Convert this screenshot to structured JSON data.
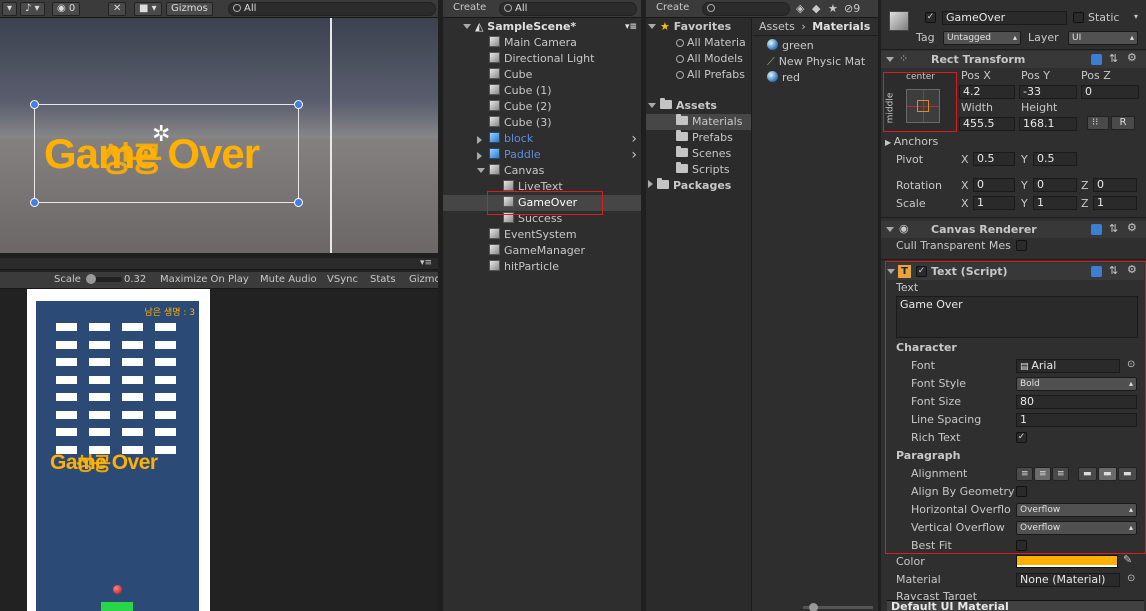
{
  "scene_view": {
    "toolbar": {
      "layers_count": "0",
      "gizmos": "Gizmos",
      "search_placeholder": "All"
    },
    "game_text": "Game Over",
    "overlap_text": "성공"
  },
  "game_view": {
    "toolbar": {
      "scale_label": "Scale",
      "scale_value": "0.32",
      "maximize": "Maximize On Play",
      "mute": "Mute Audio",
      "vsync": "VSync",
      "stats": "Stats",
      "gizmos": "Gizmos"
    },
    "lives_text": "남은 생명 : 3",
    "game_text": "Game Over",
    "overlap_text": "성공"
  },
  "hierarchy": {
    "create": "Create",
    "search_placeholder": "All",
    "scene": "SampleScene*",
    "items": [
      {
        "label": "Main Camera"
      },
      {
        "label": "Directional Light"
      },
      {
        "label": "Cube"
      },
      {
        "label": "Cube (1)"
      },
      {
        "label": "Cube (2)"
      },
      {
        "label": "Cube (3)"
      },
      {
        "label": "block"
      },
      {
        "label": "Paddle"
      },
      {
        "label": "Canvas"
      },
      {
        "label": "LiveText"
      },
      {
        "label": "GameOver"
      },
      {
        "label": "Success"
      },
      {
        "label": "EventSystem"
      },
      {
        "label": "GameManager"
      },
      {
        "label": "hitParticle"
      }
    ]
  },
  "project": {
    "create": "Create",
    "badge_count": "9",
    "favorites": {
      "title": "Favorites",
      "items": [
        "All Materia",
        "All Models",
        "All Prefabs"
      ]
    },
    "assets": {
      "title": "Assets",
      "items": [
        "Materials",
        "Prefabs",
        "Scenes",
        "Scripts"
      ]
    },
    "packages": "Packages",
    "breadcrumb": {
      "root": "Assets",
      "sep": "›",
      "current": "Materials"
    },
    "files": [
      "green",
      "New Physic Mat",
      "red"
    ]
  },
  "inspector": {
    "name": "GameOver",
    "static": "Static",
    "tag_label": "Tag",
    "tag_value": "Untagged",
    "layer_label": "Layer",
    "layer_value": "UI",
    "rect_transform": {
      "title": "Rect Transform",
      "anchor_h": "center",
      "anchor_v": "middle",
      "pos_x_label": "Pos X",
      "pos_y_label": "Pos Y",
      "pos_z_label": "Pos Z",
      "pos_x": "4.2",
      "pos_y": "-33",
      "pos_z": "0",
      "width_label": "Width",
      "height_label": "Height",
      "width": "455.5",
      "height": "168.1",
      "r_button": "R",
      "anchors": "Anchors",
      "pivot": "Pivot",
      "pivot_x": "0.5",
      "pivot_y": "0.5",
      "rotation": "Rotation",
      "rot_x": "0",
      "rot_y": "0",
      "rot_z": "0",
      "scale": "Scale",
      "scale_x": "1",
      "scale_y": "1",
      "scale_z": "1",
      "x": "X",
      "y": "Y",
      "z": "Z"
    },
    "canvas_renderer": {
      "title": "Canvas Renderer",
      "cull": "Cull Transparent Mes"
    },
    "text_script": {
      "title": "Text (Script)",
      "text_label": "Text",
      "text_value": "Game Over",
      "character": "Character",
      "font_label": "Font",
      "font_value": "Arial",
      "font_style_label": "Font Style",
      "font_style_value": "Bold",
      "font_size_label": "Font Size",
      "font_size_value": "80",
      "line_spacing_label": "Line Spacing",
      "line_spacing_value": "1",
      "rich_text_label": "Rich Text",
      "paragraph": "Paragraph",
      "alignment_label": "Alignment",
      "align_geometry_label": "Align By Geometry",
      "h_overflow_label": "Horizontal Overflo",
      "h_overflow_value": "Overflow",
      "v_overflow_label": "Vertical Overflow",
      "v_overflow_value": "Overflow",
      "best_fit_label": "Best Fit",
      "color_label": "Color",
      "material_label": "Material",
      "material_value": "None (Material)",
      "raycast_label": "Raycast Target"
    },
    "default_material": "Default UI Material"
  },
  "colors": {
    "text_color": "#ffb000",
    "selection": "#3e5f96",
    "highlight": "#d81e1e"
  }
}
